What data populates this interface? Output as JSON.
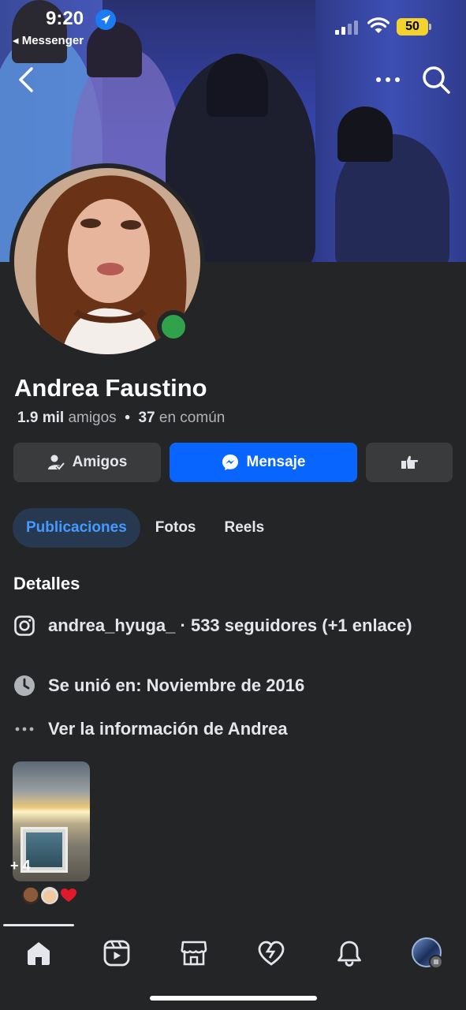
{
  "status_bar": {
    "time": "9:20",
    "back_app": "◂ Messenger",
    "battery": "50"
  },
  "profile": {
    "name": "Andrea Faustino",
    "friends_count": "1.9 mil",
    "friends_label": "amigos",
    "separator": "•",
    "mutual_count": "37",
    "mutual_label": "en común"
  },
  "actions": {
    "friends_label": "Amigos",
    "message_label": "Mensaje"
  },
  "tabs": [
    {
      "label": "Publicaciones",
      "active": true
    },
    {
      "label": "Fotos",
      "active": false
    },
    {
      "label": "Reels",
      "active": false
    }
  ],
  "details": {
    "title": "Detalles",
    "instagram": "andrea_hyuga_ · 533 seguidores (+1 enlace)",
    "joined": "Se unió en: Noviembre de 2016",
    "more_info": "Ver la información de Andrea"
  },
  "featured": {
    "count_label": "+ 4"
  },
  "colors": {
    "background": "#242526",
    "primary": "#0866ff",
    "secondary_button": "#3a3b3c",
    "active_tab_bg": "#263951",
    "active_tab_text": "#4599ff",
    "online": "#31a24c"
  },
  "bottom_nav": [
    "home-icon",
    "video-icon",
    "marketplace-icon",
    "dating-icon",
    "notifications-icon",
    "menu-avatar-icon"
  ]
}
